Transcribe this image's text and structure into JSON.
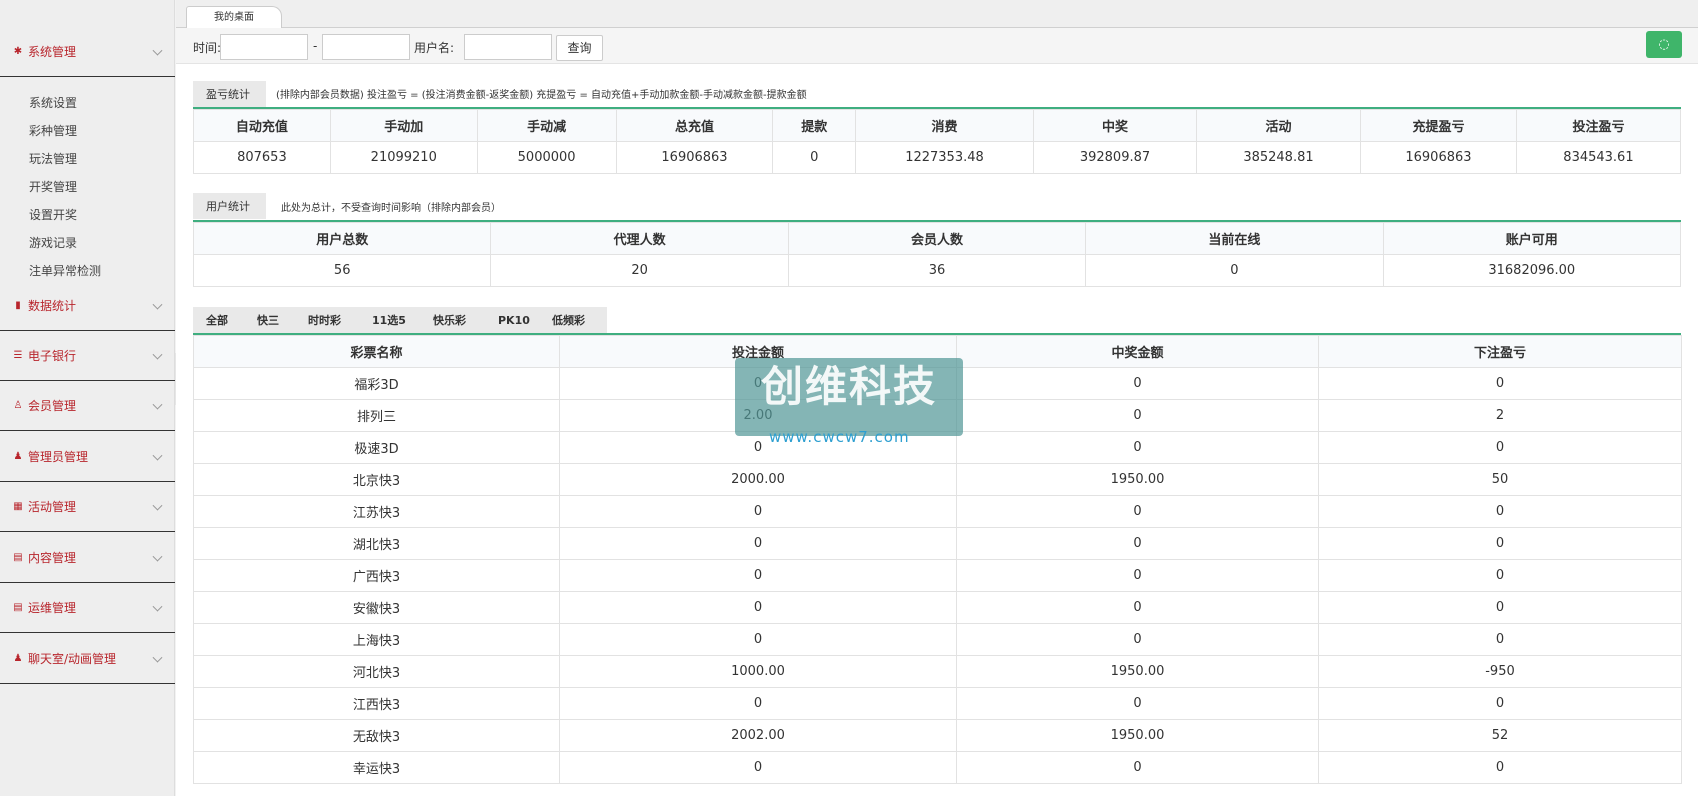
{
  "sidebar": {
    "menus": [
      {
        "label": "系统管理",
        "icon": "gear-icon",
        "glyph": "✱"
      },
      {
        "label": "数据统计",
        "icon": "bar-chart-icon",
        "glyph": "▮"
      },
      {
        "label": "电子银行",
        "icon": "list-icon",
        "glyph": "☰"
      },
      {
        "label": "会员管理",
        "icon": "user-outline-icon",
        "glyph": "♙"
      },
      {
        "label": "管理员管理",
        "icon": "user-icon",
        "glyph": "♟"
      },
      {
        "label": "活动管理",
        "icon": "gift-icon",
        "glyph": "▦"
      },
      {
        "label": "内容管理",
        "icon": "book-icon",
        "glyph": "▤"
      },
      {
        "label": "运维管理",
        "icon": "book-icon",
        "glyph": "▤"
      },
      {
        "label": "聊天室/动画管理",
        "icon": "user-icon",
        "glyph": "♟"
      }
    ],
    "sub_items": [
      "系统设置",
      "彩种管理",
      "玩法管理",
      "开奖管理",
      "设置开奖",
      "游戏记录",
      "注单异常检测"
    ]
  },
  "topbar": {
    "tab": "我的桌面"
  },
  "toolbar": {
    "time_label": "时间:",
    "dash": "-",
    "username_label": "用户名:",
    "query_button": "查询",
    "refresh_glyph": "◌"
  },
  "profit": {
    "tab": "盈亏统计",
    "note": "(排除内部会员数据)  投注盈亏 = (投注消费金额-返奖金额)     充提盈亏 = 自动充值+手动加款金额-手动减款金额-提款金额",
    "headers": [
      "自动充值",
      "手动加",
      "手动减",
      "总充值",
      "提款",
      "消费",
      "中奖",
      "活动",
      "充提盈亏",
      "投注盈亏"
    ],
    "values": [
      "807653",
      "21099210",
      "5000000",
      "16906863",
      "0",
      "1227353.48",
      "392809.87",
      "385248.81",
      "16906863",
      "834543.61"
    ]
  },
  "users": {
    "tab": "用户统计",
    "note": "此处为总计，不受查询时间影响（排除内部会员）",
    "headers": [
      "用户总数",
      "代理人数",
      "会员人数",
      "当前在线",
      "账户可用"
    ],
    "values": [
      "56",
      "20",
      "36",
      "0",
      "31682096.00"
    ]
  },
  "lottery_tabs": [
    "全部",
    "快三",
    "时时彩",
    "11选5",
    "快乐彩",
    "PK10",
    "低频彩"
  ],
  "lottery": {
    "headers": [
      "彩票名称",
      "投注金额",
      "中奖金额",
      "下注盈亏"
    ],
    "rows": [
      [
        "福彩3D",
        "0",
        "0",
        "0"
      ],
      [
        "排列三",
        "2.00",
        "0",
        "2"
      ],
      [
        "极速3D",
        "0",
        "0",
        "0"
      ],
      [
        "北京快3",
        "2000.00",
        "1950.00",
        "50"
      ],
      [
        "江苏快3",
        "0",
        "0",
        "0"
      ],
      [
        "湖北快3",
        "0",
        "0",
        "0"
      ],
      [
        "广西快3",
        "0",
        "0",
        "0"
      ],
      [
        "安徽快3",
        "0",
        "0",
        "0"
      ],
      [
        "上海快3",
        "0",
        "0",
        "0"
      ],
      [
        "河北快3",
        "1000.00",
        "1950.00",
        "-950"
      ],
      [
        "江西快3",
        "0",
        "0",
        "0"
      ],
      [
        "无敌快3",
        "2002.00",
        "1950.00",
        "52"
      ],
      [
        "幸运快3",
        "0",
        "0",
        "0"
      ]
    ]
  },
  "watermark": {
    "title": "创维科技",
    "url": "www.cwcw7.com"
  }
}
